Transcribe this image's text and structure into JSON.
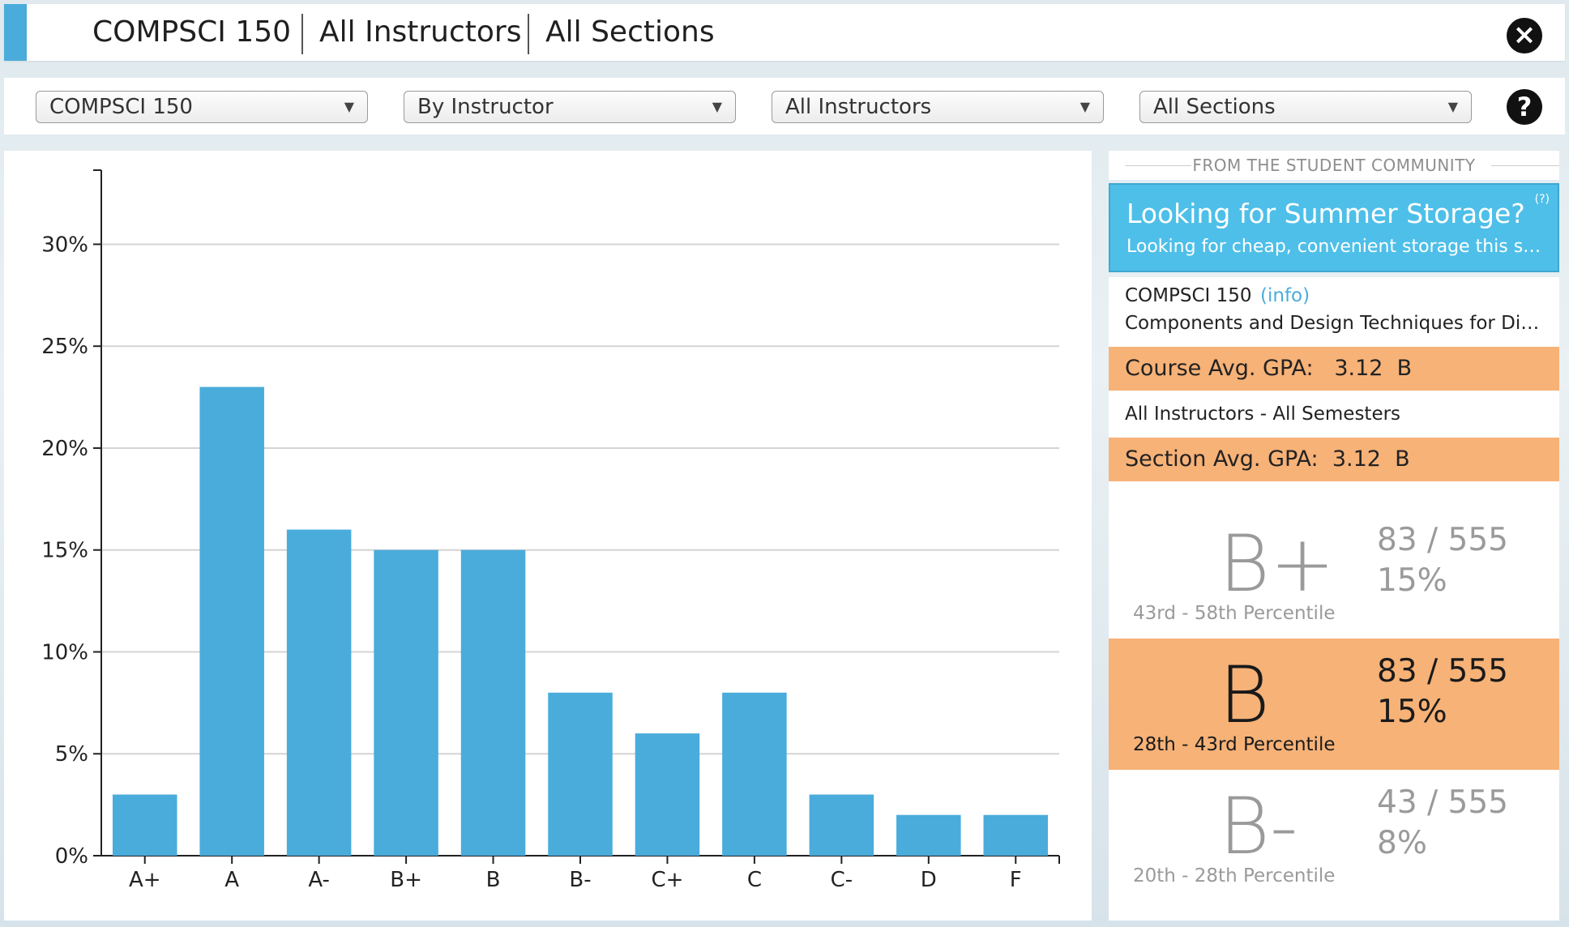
{
  "header": {
    "course": "COMPSCI 150",
    "instructor": "All Instructors",
    "section": "All Sections",
    "close_icon": "close-icon"
  },
  "filters": {
    "course_select": "COMPSCI 150",
    "mode_select": "By Instructor",
    "instructor_select": "All Instructors",
    "section_select": "All Sections",
    "caret": "▼",
    "help_icon": "help-icon"
  },
  "chart_data": {
    "type": "bar",
    "categories": [
      "A+",
      "A",
      "A-",
      "B+",
      "B",
      "B-",
      "C+",
      "C",
      "C-",
      "D",
      "F"
    ],
    "values": [
      3,
      23,
      16,
      15,
      15,
      8,
      6,
      8,
      3,
      2,
      2
    ],
    "ylim": [
      0,
      33
    ],
    "yticks": [
      0,
      5,
      10,
      15,
      20,
      25,
      30
    ],
    "ytick_suffix": "%",
    "grid": true,
    "bar_color": "#4aacdb",
    "title": "",
    "xlabel": "",
    "ylabel": ""
  },
  "sidebar": {
    "community_heading": "FROM THE STUDENT COMMUNITY",
    "ad": {
      "title": "Looking for Summer Storage?",
      "subtitle": "Looking for cheap, convenient storage this su...",
      "help_mark": "(?)"
    },
    "course": {
      "code": "COMPSCI 150",
      "info_link": "(info)",
      "name": "Components and Design Techniques for Digit...",
      "course_avg_label": "Course Avg. GPA:",
      "course_avg_value": "3.12",
      "course_avg_grade": "B",
      "instructor_scope": "All Instructors - All Semesters",
      "section_avg_label": "Section Avg. GPA:",
      "section_avg_value": "3.12",
      "section_avg_grade": "B"
    },
    "grades": [
      {
        "letter": "B+",
        "range": "43rd  -  58th Percentile",
        "count": "83 / 555",
        "share": "15%"
      },
      {
        "letter": "B",
        "range": "28th  -  43rd Percentile",
        "count": "83 / 555",
        "share": "15%"
      },
      {
        "letter": "B-",
        "range": "20th  -  28th Percentile",
        "count": "43 / 555",
        "share": "8%"
      }
    ],
    "highlight_color": "#f7b277"
  }
}
